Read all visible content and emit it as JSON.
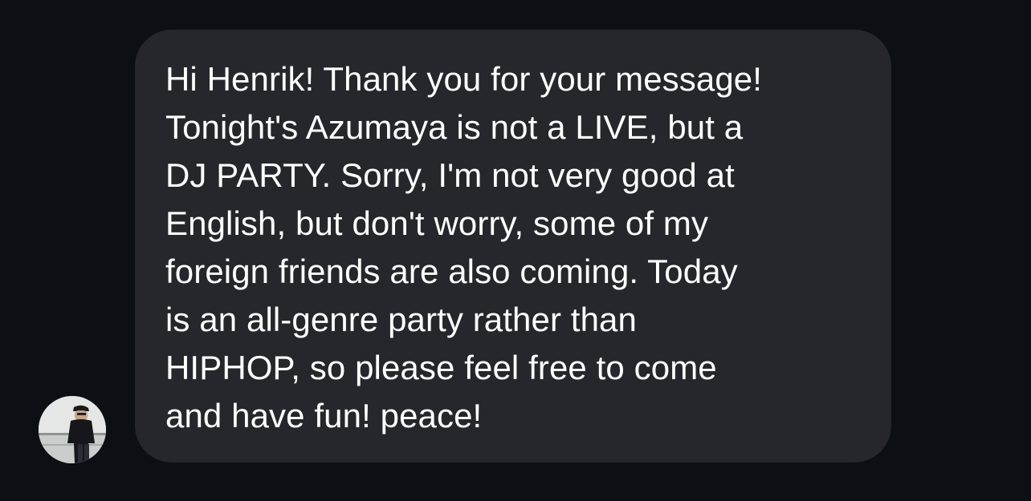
{
  "conversation": {
    "incoming_message": {
      "sender_avatar": "person-in-black-cap-avatar",
      "text": "Hi Henrik! Thank you for your message!\nTonight's Azumaya is not a LIVE, but a\nDJ PARTY. Sorry, I'm not very good at\nEnglish, but don't worry, some of my\nforeign friends are also coming. Today\nis an all-genre party rather than\nHIPHOP, so please feel free to come\nand have fun! peace!"
    }
  },
  "colors": {
    "background": "#0c0f14",
    "bubble": "#25272c",
    "text": "#ffffff"
  }
}
